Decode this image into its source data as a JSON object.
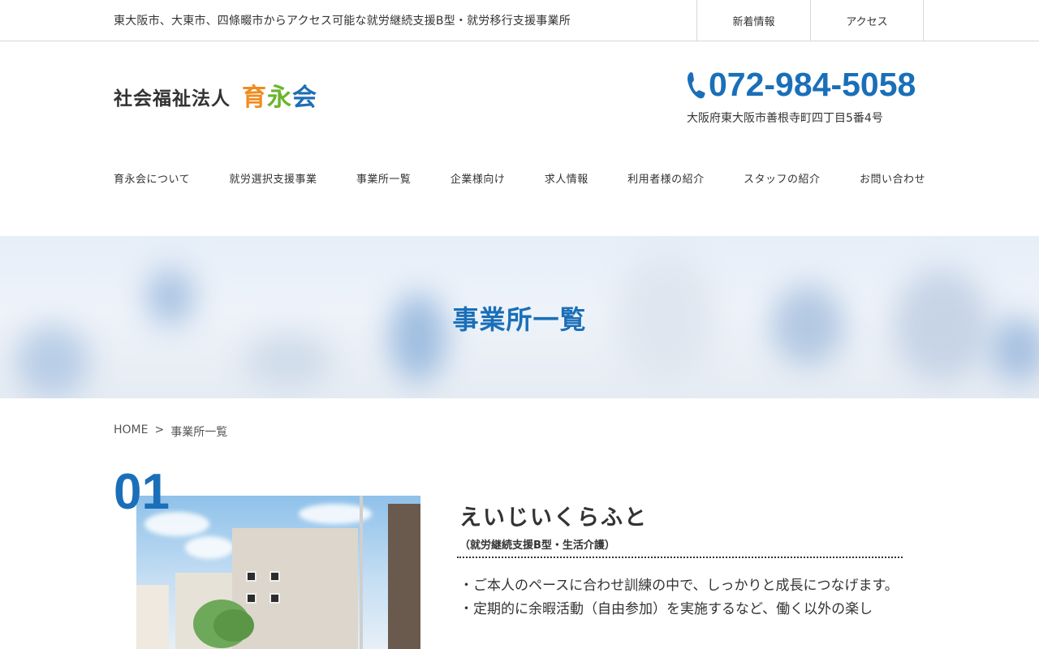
{
  "topbar": {
    "tagline": "東大阪市、大東市、四條畷市からアクセス可能な就労継続支援B型・就労移行支援事業所",
    "links": [
      "新着情報",
      "アクセス"
    ]
  },
  "header": {
    "logo_corp": "社会福祉法人",
    "logo_name": [
      "育",
      "永",
      "会"
    ],
    "logo_colors": [
      "#f08c1e",
      "#6ab42d",
      "#1e6eb4"
    ],
    "phone_icon": "phone-icon",
    "phone": "072-984-5058",
    "address": "大阪府東大阪市善根寺町四丁目5番4号"
  },
  "nav": {
    "items": [
      "育永会について",
      "就労選択支援事業",
      "事業所一覧",
      "企業様向け",
      "求人情報",
      "利用者様の紹介",
      "スタッフの紹介",
      "お問い合わせ"
    ]
  },
  "hero": {
    "title": "事業所一覧"
  },
  "breadcrumb": {
    "home": "HOME",
    "separator": ">",
    "current": "事業所一覧"
  },
  "office": {
    "number": "01",
    "name": "えいじいくらふと",
    "type": "（就労継続支援B型・生活介護）",
    "points": [
      "・ご本人のペースに合わせ訓練の中で、しっかりと成長につなげます。",
      "・定期的に余暇活動（自由参加）を実施するなど、働く以外の楽し"
    ]
  },
  "colors": {
    "accent": "#1a6fb8",
    "text": "#333333"
  }
}
